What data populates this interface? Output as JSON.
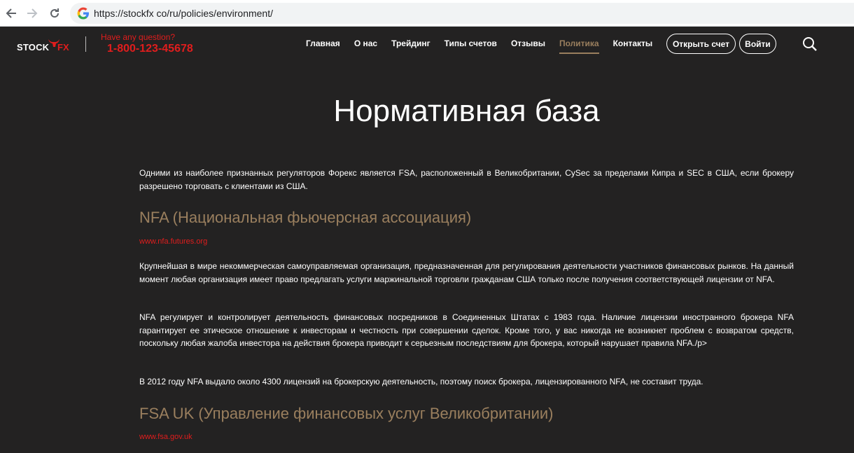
{
  "browser": {
    "url": "https://stockfx co/ru/policies/environment/"
  },
  "header": {
    "logo_stock": "STOCK",
    "logo_fx": "FX",
    "question": "Have any question?",
    "phone": "1-800-123-45678",
    "menu": [
      {
        "label": "Главная",
        "active": false
      },
      {
        "label": "О нас",
        "active": false
      },
      {
        "label": "Трейдинг",
        "active": false
      },
      {
        "label": "Типы счетов",
        "active": false
      },
      {
        "label": "Отзывы",
        "active": false
      },
      {
        "label": "Политика",
        "active": true
      },
      {
        "label": "Контакты",
        "active": false
      }
    ],
    "open_account": "Открыть счет",
    "login": "Войти"
  },
  "main": {
    "title": "Нормативная база",
    "intro": "Одними из наиболее признанных регуляторов Форекс является FSA, расположенный в Великобритании, CySec за пределами Кипра и SEC в США, если брокеру разрешено торговать с клиентами из США.",
    "nfa_heading": "NFA (Национальная фьючерсная ассоциация)",
    "nfa_link": "www.nfa.futures.org",
    "p1": "Крупнейшая в мире некоммерческая самоуправляемая организация, предназначенная для регулирования деятельности участников финансовых рынков. На данный момент любая организация имеет право предлагать услуги маржинальной торговли гражданам США только после получения соответствующей лицензии от NFA.",
    "p2": "NFA регулирует и контролирует деятельность финансовых посредников в Соединенных Штатах с 1983 года. Наличие лицензии иностранного брокера NFA гарантирует ее этическое отношение к инвесторам и честность при совершении сделок. Кроме того, у вас никогда не возникнет проблем с возвратом средств, поскольку любая жалоба инвестора на действия брокера приводит к серьезным последствиям для брокера, который нарушает правила NFA./p>",
    "p3": "В 2012 году NFA выдало около 4300 лицензий на брокерскую деятельность, поэтому поиск брокера, лицензированного NFA, не составит труда.",
    "fsa_heading": "FSA UK (Управление финансовых услуг Великобритании)",
    "fsa_link": "www.fsa.gov.uk"
  },
  "colors": {
    "background": "#232222",
    "accent_gold": "#9a7f5e",
    "accent_red": "#e01d1d"
  }
}
